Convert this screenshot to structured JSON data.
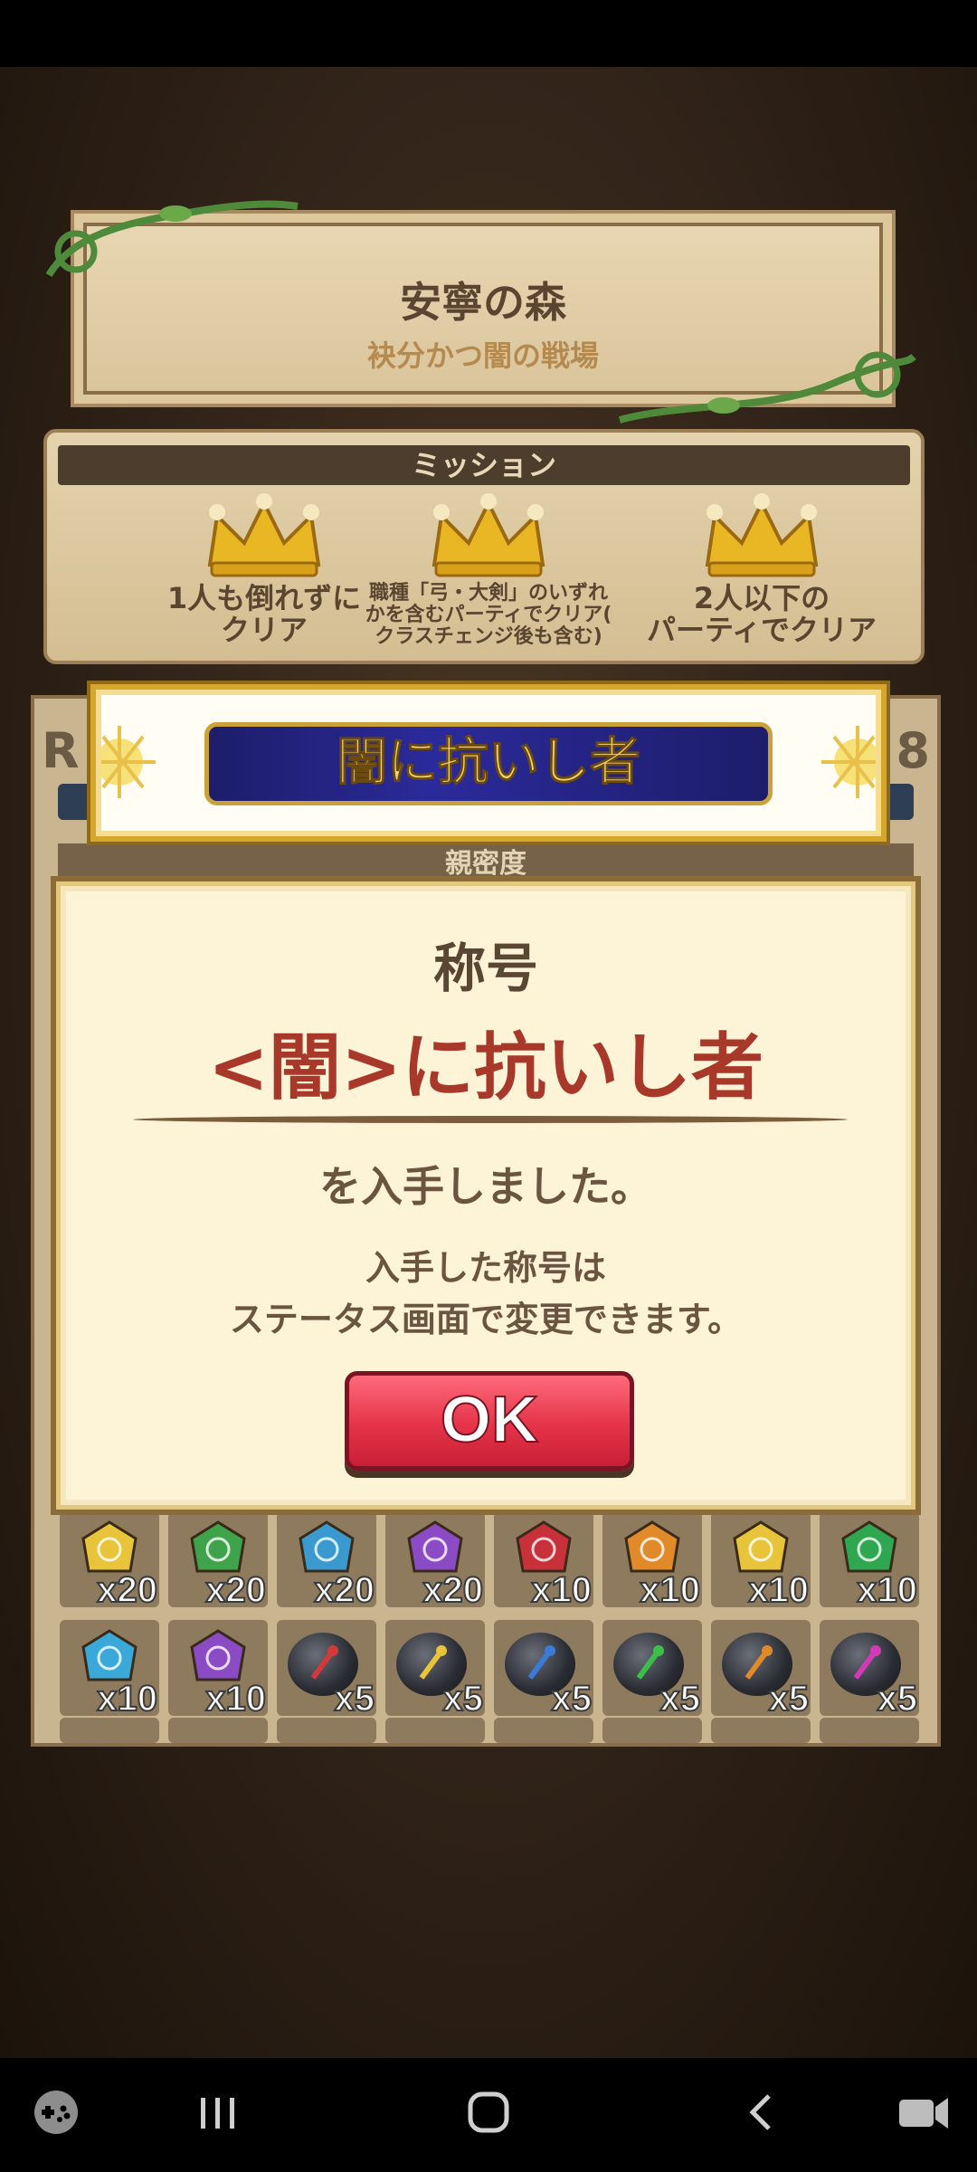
{
  "stage": {
    "title": "安寧の森",
    "subtitle": "袂分かつ闇の戦場"
  },
  "mission": {
    "header": "ミッション",
    "items": [
      {
        "text_line1": "1人も倒れずに",
        "text_line2": "クリア",
        "text_line3": ""
      },
      {
        "text_line1": "職種「弓・大剣」のいずれ",
        "text_line2": "かを含むパーティでクリア(",
        "text_line3": "クラスチェンジ後も含む)"
      },
      {
        "text_line1": "2人以下の",
        "text_line2": "パーティでクリア",
        "text_line3": ""
      }
    ]
  },
  "banner": {
    "title": "闇に抗いし者"
  },
  "inventory": {
    "left_letter": "R",
    "right_number": "8",
    "section_label": "親密度",
    "row1_counts": [
      "x20",
      "x20",
      "x20",
      "x20",
      "x10",
      "x10",
      "x10",
      "x10"
    ],
    "row1_colors": [
      "#e7c43a",
      "#3ea34a",
      "#3a9ad0",
      "#8a4bc4",
      "#c8303a",
      "#e08a2a",
      "#e7c43a",
      "#2fa650"
    ],
    "row2_counts": [
      "x10",
      "x10",
      "x5",
      "x5",
      "x5",
      "x5",
      "x5",
      "x5"
    ],
    "row2_gem_colors": [
      "#3aa8d8",
      "#8a4bc4"
    ],
    "row2_stone_accents": [
      "#d23a3a",
      "#e7c43a",
      "#3a7ad8",
      "#3ac04a",
      "#e08a2a",
      "#d23ab8"
    ]
  },
  "dialog": {
    "heading": "称号",
    "title_name": "<闇>に抗いし者",
    "obtained": "を入手しました。",
    "note_line1": "入手した称号は",
    "note_line2": "ステータス画面で変更できます。",
    "ok_label": "OK"
  },
  "colors": {
    "accent_red": "#a8382a",
    "ok_button": "#e53448",
    "banner_gold": "#d6a72c"
  }
}
